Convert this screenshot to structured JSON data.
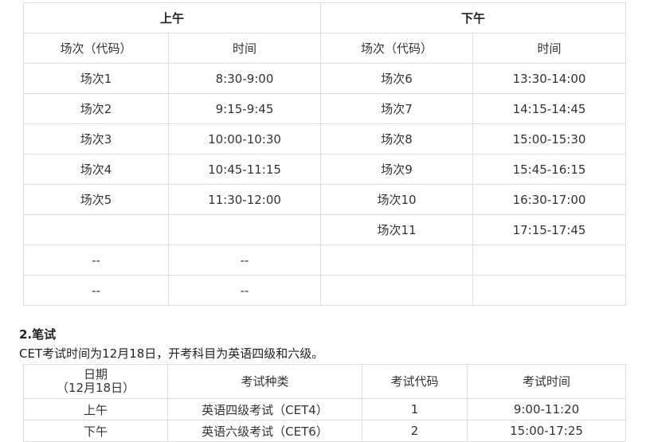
{
  "schedule": {
    "morning_label": "上午",
    "afternoon_label": "下午",
    "col_session": "场次（代码）",
    "col_time": "时间",
    "rows": [
      {
        "am_session": "场次1",
        "am_time": "8:30-9:00",
        "pm_session": "场次6",
        "pm_time": "13:30-14:00"
      },
      {
        "am_session": "场次2",
        "am_time": "9:15-9:45",
        "pm_session": "场次7",
        "pm_time": "14:15-14:45"
      },
      {
        "am_session": "场次3",
        "am_time": "10:00-10:30",
        "pm_session": "场次8",
        "pm_time": "15:00-15:30"
      },
      {
        "am_session": "场次4",
        "am_time": "10:45-11:15",
        "pm_session": "场次9",
        "pm_time": "15:45-16:15"
      },
      {
        "am_session": "场次5",
        "am_time": "11:30-12:00",
        "pm_session": "场次10",
        "pm_time": "16:30-17:00"
      },
      {
        "am_session": "",
        "am_time": "",
        "pm_session": "场次11",
        "pm_time": "17:15-17:45"
      },
      {
        "am_session": "--",
        "am_time": "--",
        "pm_session": "",
        "pm_time": ""
      },
      {
        "am_session": "--",
        "am_time": "--",
        "pm_session": "",
        "pm_time": ""
      }
    ]
  },
  "written": {
    "heading": "2.笔试",
    "description": "CET考试时间为12月18日，开考科目为英语四级和六级。",
    "headers": {
      "date_line1": "日期",
      "date_line2": "（12月18日）",
      "exam_type": "考试种类",
      "exam_code": "考试代码",
      "exam_time": "考试时间"
    },
    "rows": [
      {
        "period": "上午",
        "exam": "英语四级考试（CET4）",
        "code": "1",
        "time": "9:00-11:20"
      },
      {
        "period": "下午",
        "exam": "英语六级考试（CET6）",
        "code": "2",
        "time": "15:00-17:25"
      }
    ]
  }
}
